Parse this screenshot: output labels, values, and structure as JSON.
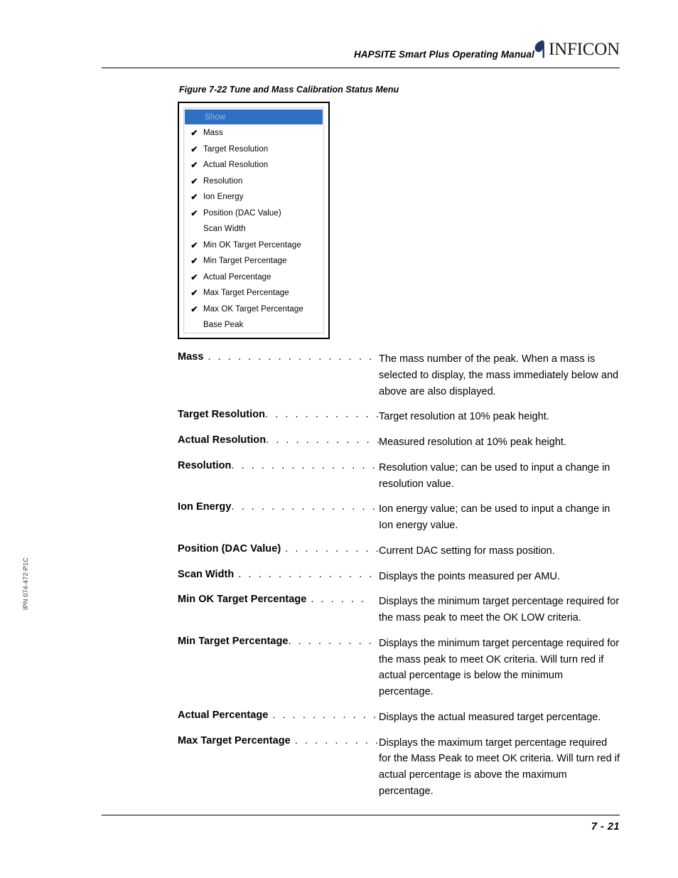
{
  "header": {
    "title": "HAPSITE Smart Plus Operating Manual",
    "logo_text": "INFICON",
    "logo_color": "#1f3864"
  },
  "side_code": "IPN 074-472-P1C",
  "figure": {
    "caption": "Figure 7-22  Tune and Mass Calibration Status Menu",
    "menu": {
      "highlight_color": "#2f6fc4",
      "items": [
        {
          "label": "Show",
          "checked": false,
          "header": true
        },
        {
          "label": "Mass",
          "checked": true,
          "header": false
        },
        {
          "label": "Target Resolution",
          "checked": true,
          "header": false
        },
        {
          "label": "Actual Resolution",
          "checked": true,
          "header": false
        },
        {
          "label": "Resolution",
          "checked": true,
          "header": false
        },
        {
          "label": "Ion Energy",
          "checked": true,
          "header": false
        },
        {
          "label": "Position (DAC Value)",
          "checked": true,
          "header": false
        },
        {
          "label": "Scan Width",
          "checked": false,
          "header": false
        },
        {
          "label": "Min OK Target Percentage",
          "checked": true,
          "header": false
        },
        {
          "label": "Min Target Percentage",
          "checked": true,
          "header": false
        },
        {
          "label": "Actual Percentage",
          "checked": true,
          "header": false
        },
        {
          "label": "Max Target Percentage",
          "checked": true,
          "header": false
        },
        {
          "label": "Max OK Target Percentage",
          "checked": true,
          "header": false
        },
        {
          "label": "Base Peak",
          "checked": false,
          "header": false
        }
      ],
      "check_glyph": "✔"
    }
  },
  "definitions": [
    {
      "term": "Mass",
      "leader": ". . . . . . . . . . . . . . . . . . . . . . .",
      "gap": true,
      "description": "The mass number of the peak. When a mass is selected to display, the mass immediately below and above are also displayed."
    },
    {
      "term": "Target Resolution",
      "leader": ". . . . . . . . . . . . . .",
      "gap": false,
      "description": "Target resolution at 10% peak height."
    },
    {
      "term": "Actual Resolution",
      "leader": ". . . . . . . . . . . . . .",
      "gap": false,
      "description": "Measured resolution at 10% peak height."
    },
    {
      "term": "Resolution",
      "leader": ". . . . . . . . . . . . . . . . . . .",
      "gap": false,
      "description": "Resolution value; can be used to input a change in resolution value."
    },
    {
      "term": "Ion Energy",
      "leader": ". . . . . . . . . . . . . . . . . . .",
      "gap": false,
      "description": "Ion energy value; can be used to input a change in Ion energy value."
    },
    {
      "term": "Position (DAC Value)",
      "leader": ". . . . . . . . . . .",
      "gap": true,
      "description": "Current DAC setting for mass position."
    },
    {
      "term": "Scan Width",
      "leader": ". . . . . . . . . . . . . . . . . .",
      "gap": true,
      "description": "Displays the points measured per AMU."
    },
    {
      "term": "Min OK Target Percentage",
      "leader": ". . . . . .",
      "gap": true,
      "description": "Displays the minimum target percentage required for the mass peak to meet the OK LOW criteria."
    },
    {
      "term": "Min Target Percentage",
      "leader": ". . . . . . . . . .",
      "gap": false,
      "description": "Displays the minimum target percentage required for the mass peak to meet OK criteria. Will turn red if actual percentage is below the minimum percentage."
    },
    {
      "term": "Actual Percentage",
      "leader": ". . . . . . . . . . . . .",
      "gap": true,
      "description": "Displays the actual measured target percentage."
    },
    {
      "term": "Max Target Percentage",
      "leader": ". . . . . . . . .",
      "gap": true,
      "description": "Displays the maximum target percentage required for the Mass Peak to meet OK criteria. Will turn red if actual percentage is above the maximum percentage."
    }
  ],
  "footer": {
    "page_number": "7 - 21"
  }
}
